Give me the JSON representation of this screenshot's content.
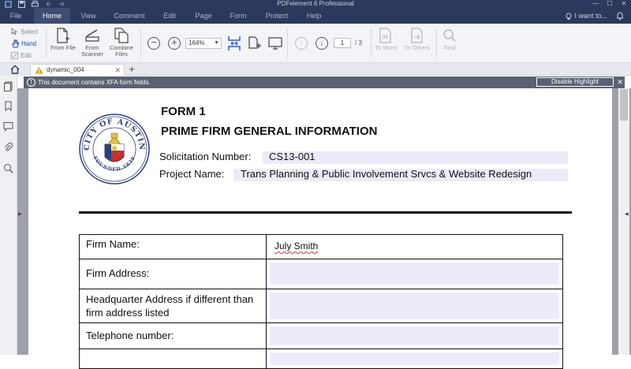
{
  "app": {
    "title": "PDFelement 6 Professional"
  },
  "menu": {
    "items": [
      "File",
      "Home",
      "View",
      "Comment",
      "Edit",
      "Page",
      "Form",
      "Protect",
      "Help"
    ],
    "active": "Home",
    "search_label": "I want to..."
  },
  "ribbon": {
    "select_label": "Select",
    "hand_label": "Hand",
    "edit_label": "Edit",
    "from_file_label": "From File",
    "from_scanner_label": "From Scanner",
    "combine_files_label": "Combine Files",
    "zoom_value": "164%",
    "page_current": "1",
    "page_total": "/ 3",
    "to_word_label": "To Word",
    "to_others_label": "To Others",
    "find_label": "Find"
  },
  "tabs": {
    "doc_name": "dynamic_004"
  },
  "notification": {
    "message": "This document contains XFA form fields.",
    "button_label": "Disable Highlight"
  },
  "document": {
    "form_title": "FORM 1",
    "form_subtitle": "PRIME FIRM GENERAL INFORMATION",
    "solicitation_label": "Solicitation Number:",
    "solicitation_value": "CS13-001",
    "project_label": "Project Name:",
    "project_value": "Trans Planning & Public Involvement Srvcs & Website Redesign",
    "seal_top_text": "CITY OF AUSTIN",
    "seal_bottom_text": "FOUNDED 1839",
    "rows": [
      {
        "label": "Firm Name:",
        "value": "July Smith"
      },
      {
        "label": "Firm Address:",
        "value": ""
      },
      {
        "label": "Headquarter Address if different than firm address listed",
        "value": ""
      },
      {
        "label": "Telephone number:",
        "value": ""
      }
    ]
  },
  "colors": {
    "menu_bg": "#2b3a5c",
    "accent": "#1f4bb5",
    "notification_bg": "#5b6174",
    "field_highlight": "#ecebfa"
  }
}
